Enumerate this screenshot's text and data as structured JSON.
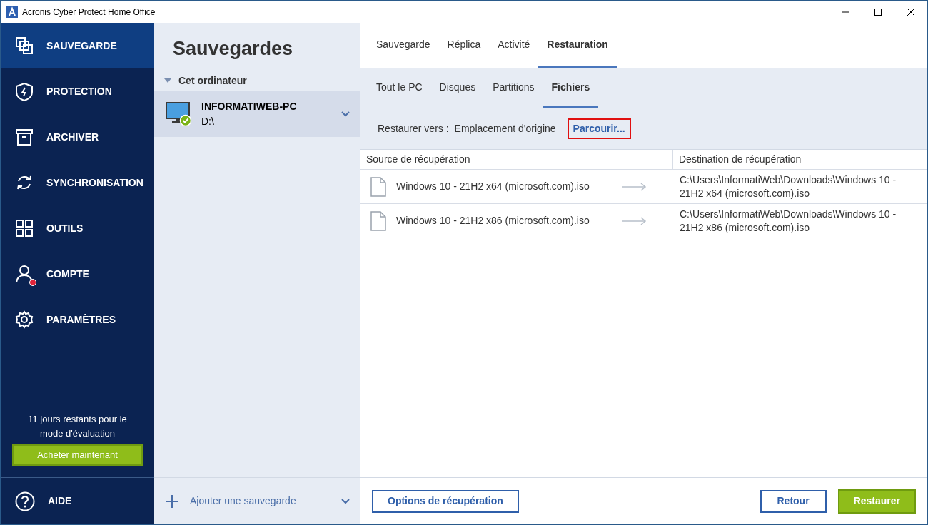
{
  "window": {
    "title": "Acronis Cyber Protect Home Office"
  },
  "sidebar": {
    "items": [
      {
        "label": "SAUVEGARDE",
        "selected": true,
        "alert": false
      },
      {
        "label": "PROTECTION",
        "selected": false,
        "alert": false
      },
      {
        "label": "ARCHIVER",
        "selected": false,
        "alert": false
      },
      {
        "label": "SYNCHRONISATION",
        "selected": false,
        "alert": false
      },
      {
        "label": "OUTILS",
        "selected": false,
        "alert": false
      },
      {
        "label": "COMPTE",
        "selected": false,
        "alert": true
      },
      {
        "label": "PARAMÈTRES",
        "selected": false,
        "alert": false
      }
    ],
    "trial_text": "11 jours restants pour le mode d'évaluation",
    "buy_button": "Acheter maintenant",
    "help": "AIDE"
  },
  "backups_panel": {
    "title": "Sauvegardes",
    "group": {
      "label": "Cet ordinateur",
      "expanded": true
    },
    "backups": [
      {
        "name": "INFORMATIWEB-PC",
        "location": "D:\\",
        "selected": true,
        "status_ok": true
      }
    ],
    "add_button": "Ajouter une sauvegarde"
  },
  "tabs": [
    {
      "label": "Sauvegarde",
      "selected": false
    },
    {
      "label": "Réplica",
      "selected": false
    },
    {
      "label": "Activité",
      "selected": false
    },
    {
      "label": "Restauration",
      "selected": true
    }
  ],
  "subtabs": [
    {
      "label": "Tout le PC",
      "selected": false
    },
    {
      "label": "Disques",
      "selected": false
    },
    {
      "label": "Partitions",
      "selected": false
    },
    {
      "label": "Fichiers",
      "selected": true
    }
  ],
  "restore_to": {
    "label": "Restaurer vers :",
    "value": "Emplacement d'origine",
    "browse_link": "Parcourir...",
    "highlighted": true
  },
  "table": {
    "columns": [
      "Source de récupération",
      "Destination de récupération"
    ],
    "rows": [
      {
        "source": "Windows 10 - 21H2 x64 (microsoft.com).iso",
        "destination": "C:\\Users\\InformatiWeb\\Downloads\\Windows 10 - 21H2 x64 (microsoft.com).iso"
      },
      {
        "source": "Windows 10 - 21H2 x86 (microsoft.com).iso",
        "destination": "C:\\Users\\InformatiWeb\\Downloads\\Windows 10 - 21H2 x86 (microsoft.com).iso"
      }
    ]
  },
  "footer": {
    "options_button": "Options de récupération",
    "back_button": "Retour",
    "restore_button": "Restaurer"
  }
}
